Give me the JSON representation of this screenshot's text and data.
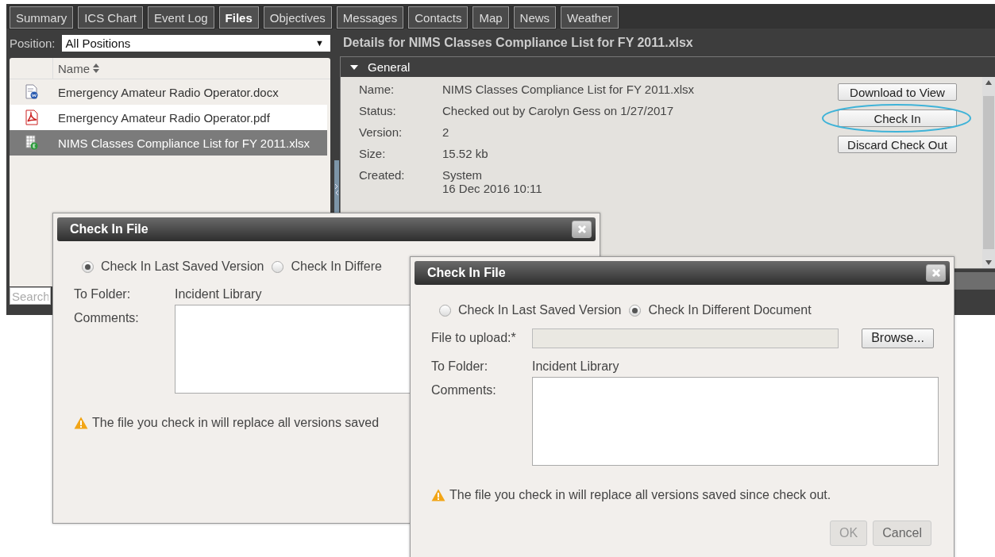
{
  "tabs": [
    {
      "label": "Summary",
      "selected": false
    },
    {
      "label": "ICS Chart",
      "selected": false
    },
    {
      "label": "Event Log",
      "selected": false
    },
    {
      "label": "Files",
      "selected": true
    },
    {
      "label": "Objectives",
      "selected": false
    },
    {
      "label": "Messages",
      "selected": false
    },
    {
      "label": "Contacts",
      "selected": false
    },
    {
      "label": "Map",
      "selected": false
    },
    {
      "label": "News",
      "selected": false
    },
    {
      "label": "Weather",
      "selected": false
    }
  ],
  "position": {
    "label": "Position:",
    "value": "All Positions",
    "caret": "▼"
  },
  "files": {
    "column": "Name",
    "rows": [
      {
        "kind": "docx",
        "name": "Emergency Amateur Radio Operator.docx",
        "selected": false
      },
      {
        "kind": "pdf",
        "name": "Emergency Amateur Radio Operator.pdf",
        "selected": false
      },
      {
        "kind": "xlsx",
        "name": "NIMS Classes Compliance List for FY 2011.xlsx",
        "selected": true
      }
    ]
  },
  "search": {
    "placeholder": "Search"
  },
  "details": {
    "title": "Details for NIMS Classes Compliance List for FY 2011.xlsx",
    "section": {
      "title": "General",
      "expanded": true
    },
    "fields": [
      {
        "label": "Name:",
        "value": [
          "NIMS Classes Compliance List for FY 2011.xlsx"
        ]
      },
      {
        "label": "Status:",
        "value": [
          "Checked out by Carolyn Gess on 1/27/2017"
        ]
      },
      {
        "label": "Version:",
        "value": [
          "2"
        ]
      },
      {
        "label": "Size:",
        "value": [
          "15.52 kb"
        ]
      },
      {
        "label": "Created:",
        "value": [
          "System",
          "16 Dec 2016 10:11"
        ]
      }
    ],
    "actions": [
      {
        "label": "Download to View",
        "highlighted": false
      },
      {
        "label": "Check In",
        "highlighted": true
      },
      {
        "label": "Discard Check Out",
        "highlighted": false
      }
    ]
  },
  "dialogs": [
    {
      "title": "Check In File",
      "options": [
        {
          "label": "Check In Last Saved Version",
          "selected": true
        },
        {
          "label": "Check In Differe",
          "selected": false
        }
      ],
      "folder": {
        "label": "To Folder:",
        "value": "Incident Library"
      },
      "comments": {
        "label": "Comments:"
      },
      "warning": "The file you check in will replace all versions saved"
    },
    {
      "title": "Check In File",
      "options": [
        {
          "label": "Check In Last Saved Version",
          "selected": false
        },
        {
          "label": "Check In Different Document",
          "selected": true
        }
      ],
      "upload": {
        "label": "File to upload:*",
        "browse": "Browse..."
      },
      "folder": {
        "label": "To Folder:",
        "value": "Incident Library"
      },
      "comments": {
        "label": "Comments:"
      },
      "warning": "The file you check in will replace all versions saved since check out.",
      "buttons": [
        {
          "label": "OK",
          "disabled": true
        },
        {
          "label": "Cancel",
          "disabled": false
        }
      ]
    }
  ]
}
